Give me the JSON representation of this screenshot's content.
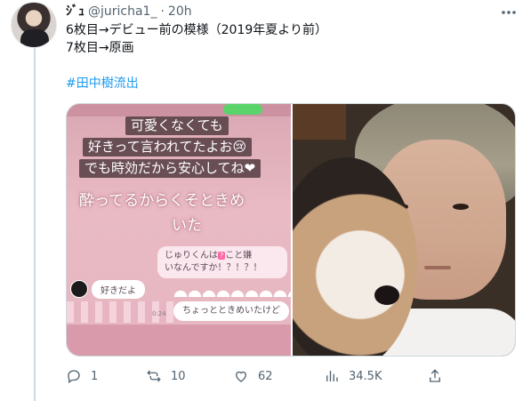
{
  "tweet": {
    "display_name": "ｼﾞｭ",
    "handle": "@juricha1_",
    "separator": "·",
    "time": "20h",
    "more_icon": "ellipsis-icon",
    "lines": [
      "6枚目→デビュー前の模様（2019年夏より前）",
      "7枚目→原画"
    ],
    "hashtag": "#田中樹流出"
  },
  "media": {
    "left_image": {
      "caption_lines": [
        "可愛くなくても",
        "好きって言われてたよお😢",
        "でも時効だから安心してね❤"
      ],
      "big_text_lines": [
        "酔ってるからくそときめ",
        "いた"
      ],
      "dm_question": [
        "じゅりくんは",
        "?",
        "こと嫌",
        "いなんですか！？！？！"
      ],
      "dm_left": "好きだよ",
      "dm_right": "ちょっとときめいたけど",
      "dm_time": "0:24"
    }
  },
  "actions": {
    "reply": {
      "icon": "reply-icon",
      "count": "1"
    },
    "retweet": {
      "icon": "retweet-icon",
      "count": "10"
    },
    "like": {
      "icon": "heart-icon",
      "count": "62"
    },
    "views": {
      "icon": "views-icon",
      "count": "34.5K"
    },
    "share": {
      "icon": "share-icon"
    }
  },
  "colors": {
    "accent": "#1d9bf0",
    "secondary_text": "#536471",
    "border": "#cfd9de"
  }
}
